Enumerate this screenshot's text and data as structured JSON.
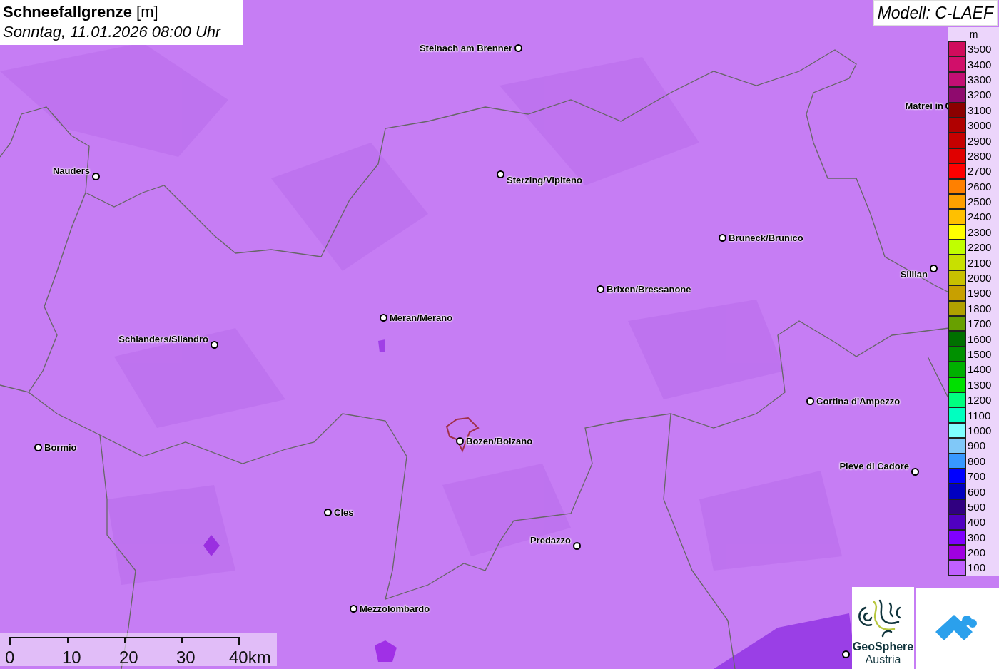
{
  "title": {
    "text": "**Schneefallgrenze** [m]",
    "subtitle": "Sonntag, 11.01.2026 08:00 Uhr"
  },
  "model": "Modell: C-LAEF",
  "legend": {
    "unit": "m",
    "steps": [
      {
        "label": "3500",
        "color": "#d00c5c"
      },
      {
        "label": "3400",
        "color": "#d10f6a"
      },
      {
        "label": "3300",
        "color": "#c30f74"
      },
      {
        "label": "3200",
        "color": "#8f0a6e"
      },
      {
        "label": "3100",
        "color": "#8b0000"
      },
      {
        "label": "3000",
        "color": "#b00000"
      },
      {
        "label": "2900",
        "color": "#c60000"
      },
      {
        "label": "2800",
        "color": "#e00000"
      },
      {
        "label": "2700",
        "color": "#ff0000"
      },
      {
        "label": "2600",
        "color": "#ff8000"
      },
      {
        "label": "2500",
        "color": "#ffa000"
      },
      {
        "label": "2400",
        "color": "#ffc000"
      },
      {
        "label": "2300",
        "color": "#ffff00"
      },
      {
        "label": "2200",
        "color": "#c0ff00"
      },
      {
        "label": "2100",
        "color": "#c8e000"
      },
      {
        "label": "2000",
        "color": "#c8c000"
      },
      {
        "label": "1900",
        "color": "#c8a000"
      },
      {
        "label": "1800",
        "color": "#b0a000"
      },
      {
        "label": "1700",
        "color": "#68a000"
      },
      {
        "label": "1600",
        "color": "#007000"
      },
      {
        "label": "1500",
        "color": "#009000"
      },
      {
        "label": "1400",
        "color": "#00b000"
      },
      {
        "label": "1300",
        "color": "#00e000"
      },
      {
        "label": "1200",
        "color": "#00ff80"
      },
      {
        "label": "1100",
        "color": "#00ffc0"
      },
      {
        "label": "1000",
        "color": "#80ffff"
      },
      {
        "label": "900",
        "color": "#80c8f8"
      },
      {
        "label": "800",
        "color": "#3898ff"
      },
      {
        "label": "700",
        "color": "#0000ff"
      },
      {
        "label": "600",
        "color": "#0000c0"
      },
      {
        "label": "500",
        "color": "#300080"
      },
      {
        "label": "400",
        "color": "#5000c0"
      },
      {
        "label": "300",
        "color": "#8000ff"
      },
      {
        "label": "200",
        "color": "#a000e0"
      },
      {
        "label": "100",
        "color": "#c060ff"
      }
    ]
  },
  "towns": [
    {
      "name": "Steinach am Brenner"
    },
    {
      "name": "Matrei in"
    },
    {
      "name": "Nauders"
    },
    {
      "name": "Sterzing/Vipiteno"
    },
    {
      "name": "Bruneck/Brunico"
    },
    {
      "name": "Sillian"
    },
    {
      "name": "Brixen/Bressanone"
    },
    {
      "name": "Meran/Merano"
    },
    {
      "name": "Schlanders/Silandro"
    },
    {
      "name": "Cortina d'Ampezzo"
    },
    {
      "name": "Bormio"
    },
    {
      "name": "Bozen/Bolzano"
    },
    {
      "name": "Pieve di Cadore"
    },
    {
      "name": "Cles"
    },
    {
      "name": "Predazzo"
    },
    {
      "name": "Mezzolombardo"
    }
  ],
  "scale": {
    "ticks": [
      "0",
      "10",
      "20",
      "30",
      "40km"
    ]
  },
  "logo": {
    "line1": "GeoSphere",
    "line2": "Austria"
  }
}
